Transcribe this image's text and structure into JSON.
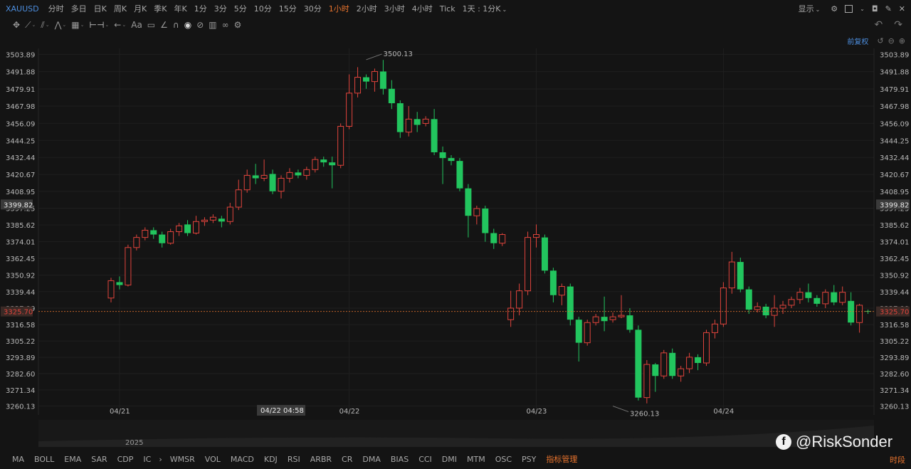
{
  "symbol": "XAUUSD",
  "timeframes": [
    {
      "label": "分时",
      "active": false
    },
    {
      "label": "多日",
      "active": false
    },
    {
      "label": "日K",
      "active": false
    },
    {
      "label": "周K",
      "active": false
    },
    {
      "label": "月K",
      "active": false
    },
    {
      "label": "季K",
      "active": false
    },
    {
      "label": "年K",
      "active": false
    },
    {
      "label": "1分",
      "active": false
    },
    {
      "label": "3分",
      "active": false
    },
    {
      "label": "5分",
      "active": false
    },
    {
      "label": "10分",
      "active": false
    },
    {
      "label": "15分",
      "active": false
    },
    {
      "label": "30分",
      "active": false
    },
    {
      "label": "1小时",
      "active": true
    },
    {
      "label": "2小时",
      "active": false
    },
    {
      "label": "3小时",
      "active": false
    },
    {
      "label": "4小时",
      "active": false
    },
    {
      "label": "Tick",
      "active": false
    },
    {
      "label": "1天 : 1分K",
      "active": false
    }
  ],
  "display_label": "显示",
  "adjust_label": "前复权",
  "indicators": [
    "MA",
    "BOLL",
    "EMA",
    "SAR",
    "CDP",
    "IC",
    "WMSR",
    "VOL",
    "MACD",
    "KDJ",
    "RSI",
    "ARBR",
    "CR",
    "DMA",
    "BIAS",
    "CCI",
    "DMI",
    "MTM",
    "OSC",
    "PSY"
  ],
  "indicator_manager_label": "指标管理",
  "period_label": "时段",
  "year_label": "2025",
  "watermark": "@RiskSonder",
  "colors": {
    "up": "#e0443c",
    "down": "#22c55e",
    "accent": "#e8732d",
    "link": "#4d8fe0"
  },
  "chart_data": {
    "type": "candlestick",
    "ylim": [
      3254,
      3508
    ],
    "y_ticks": [
      "3503.89",
      "3491.88",
      "3479.91",
      "3467.98",
      "3456.09",
      "3444.25",
      "3432.44",
      "3420.67",
      "3408.95",
      "3397.25",
      "3385.62",
      "3374.01",
      "3362.45",
      "3350.92",
      "3339.44",
      "3327.99",
      "3316.58",
      "3305.22",
      "3293.89",
      "3282.60",
      "3271.34",
      "3260.13"
    ],
    "x_labels": [
      {
        "label": "04/21",
        "index": 1
      },
      {
        "label": "04/22",
        "index": 28
      },
      {
        "label": "04/23",
        "index": 50
      },
      {
        "label": "04/24",
        "index": 72
      }
    ],
    "crosshair_x_label": "04/22 04:58",
    "crosshair_x_index": 20,
    "crosshair_y_label": "3399.82",
    "crosshair_y_value": 3399.82,
    "last_price_label": "3325.70",
    "last_price": 3325.7,
    "high_annotation": {
      "label": "3500.13",
      "index": 30,
      "value": 3500.13
    },
    "low_annotation": {
      "label": "3260.13",
      "index": 59,
      "value": 3260.13
    },
    "candles": [
      [
        3335,
        3347,
        3332,
        3349
      ],
      [
        3346,
        3344,
        3341,
        3350
      ],
      [
        3344,
        3370,
        3343,
        3372
      ],
      [
        3370,
        3377,
        3368,
        3379
      ],
      [
        3377,
        3382,
        3375,
        3384
      ],
      [
        3382,
        3379,
        3376,
        3384
      ],
      [
        3379,
        3373,
        3370,
        3381
      ],
      [
        3373,
        3381,
        3372,
        3383
      ],
      [
        3381,
        3385,
        3378,
        3387
      ],
      [
        3386,
        3380,
        3378,
        3389
      ],
      [
        3380,
        3388,
        3379,
        3392
      ],
      [
        3388,
        3389,
        3385,
        3391
      ],
      [
        3389,
        3391,
        3387,
        3393
      ],
      [
        3390,
        3388,
        3384,
        3392
      ],
      [
        3388,
        3398,
        3386,
        3401
      ],
      [
        3398,
        3410,
        3396,
        3417
      ],
      [
        3410,
        3420,
        3408,
        3424
      ],
      [
        3420,
        3418,
        3414,
        3428
      ],
      [
        3418,
        3420,
        3416,
        3431
      ],
      [
        3421,
        3409,
        3407,
        3424
      ],
      [
        3409,
        3418,
        3404,
        3420
      ],
      [
        3418,
        3422,
        3415,
        3425
      ],
      [
        3422,
        3420,
        3418,
        3424
      ],
      [
        3420,
        3424,
        3417,
        3426
      ],
      [
        3424,
        3431,
        3422,
        3433
      ],
      [
        3431,
        3429,
        3426,
        3433
      ],
      [
        3429,
        3427,
        3411,
        3433
      ],
      [
        3427,
        3454,
        3425,
        3456
      ],
      [
        3454,
        3477,
        3452,
        3490
      ],
      [
        3477,
        3488,
        3474,
        3495
      ],
      [
        3488,
        3485,
        3480,
        3490
      ],
      [
        3485,
        3492,
        3478,
        3494
      ],
      [
        3492,
        3480,
        3476,
        3500
      ],
      [
        3480,
        3470,
        3466,
        3486
      ],
      [
        3470,
        3450,
        3446,
        3472
      ],
      [
        3450,
        3459,
        3447,
        3468
      ],
      [
        3459,
        3455,
        3450,
        3464
      ],
      [
        3456,
        3459,
        3454,
        3461
      ],
      [
        3459,
        3436,
        3434,
        3466
      ],
      [
        3436,
        3432,
        3414,
        3440
      ],
      [
        3432,
        3430,
        3427,
        3434
      ],
      [
        3430,
        3411,
        3409,
        3432
      ],
      [
        3411,
        3392,
        3377,
        3414
      ],
      [
        3392,
        3397,
        3386,
        3399
      ],
      [
        3397,
        3380,
        3374,
        3399
      ],
      [
        3380,
        3373,
        3369,
        3383
      ],
      [
        3373,
        3379,
        3371,
        3380
      ],
      [
        3320,
        3328,
        3315,
        3340
      ],
      [
        3328,
        3340,
        3323,
        3345
      ],
      [
        3340,
        3377,
        3337,
        3381
      ],
      [
        3377,
        3379,
        3370,
        3386
      ],
      [
        3377,
        3354,
        3352,
        3379
      ],
      [
        3354,
        3337,
        3332,
        3356
      ],
      [
        3337,
        3343,
        3330,
        3345
      ],
      [
        3343,
        3320,
        3316,
        3345
      ],
      [
        3320,
        3304,
        3291,
        3322
      ],
      [
        3304,
        3318,
        3302,
        3320
      ],
      [
        3318,
        3322,
        3316,
        3324
      ],
      [
        3322,
        3319,
        3312,
        3336
      ],
      [
        3320,
        3322,
        3318,
        3325
      ],
      [
        3322,
        3323,
        3321,
        3337
      ],
      [
        3323,
        3313,
        3311,
        3328
      ],
      [
        3313,
        3266,
        3264,
        3316
      ],
      [
        3266,
        3289,
        3262,
        3292
      ],
      [
        3289,
        3281,
        3270,
        3290
      ],
      [
        3281,
        3297,
        3279,
        3299
      ],
      [
        3297,
        3281,
        3279,
        3300
      ],
      [
        3281,
        3286,
        3277,
        3288
      ],
      [
        3286,
        3294,
        3283,
        3297
      ],
      [
        3294,
        3290,
        3285,
        3296
      ],
      [
        3290,
        3311,
        3288,
        3313
      ],
      [
        3311,
        3317,
        3307,
        3320
      ],
      [
        3317,
        3342,
        3315,
        3346
      ],
      [
        3342,
        3360,
        3338,
        3367
      ],
      [
        3360,
        3341,
        3339,
        3363
      ],
      [
        3341,
        3327,
        3324,
        3343
      ],
      [
        3327,
        3329,
        3325,
        3332
      ],
      [
        3329,
        3323,
        3321,
        3331
      ],
      [
        3323,
        3328,
        3315,
        3337
      ],
      [
        3328,
        3330,
        3324,
        3333
      ],
      [
        3330,
        3334,
        3328,
        3336
      ],
      [
        3334,
        3339,
        3331,
        3342
      ],
      [
        3339,
        3335,
        3332,
        3345
      ],
      [
        3335,
        3331,
        3329,
        3337
      ],
      [
        3331,
        3339,
        3328,
        3341
      ],
      [
        3339,
        3332,
        3330,
        3344
      ],
      [
        3332,
        3339,
        3330,
        3343
      ],
      [
        3333,
        3318,
        3316,
        3339
      ],
      [
        3318,
        3330,
        3311,
        3331
      ],
      [
        3326,
        3325.7,
        3324,
        3327
      ]
    ]
  }
}
